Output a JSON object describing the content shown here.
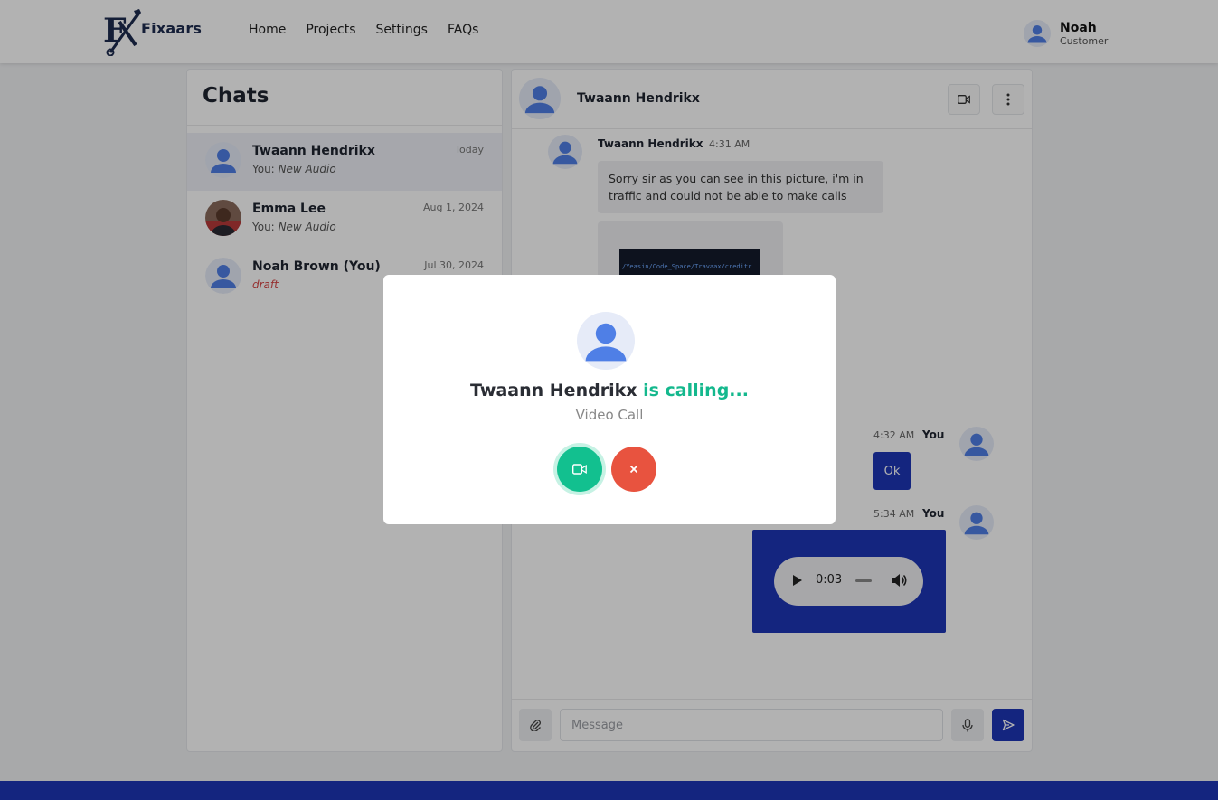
{
  "brand": {
    "name": "Fixaars",
    "logo_letters": "FX"
  },
  "nav": {
    "items": [
      "Home",
      "Projects",
      "Settings",
      "FAQs"
    ]
  },
  "user": {
    "name": "Noah",
    "role": "Customer"
  },
  "chats": {
    "title": "Chats",
    "items": [
      {
        "name": "Twaann Hendrikx",
        "prefix": "You:",
        "preview": "New Audio",
        "date": "Today",
        "active": true
      },
      {
        "name": "Emma Lee",
        "prefix": "You:",
        "preview": "New Audio",
        "date": "Aug 1, 2024"
      },
      {
        "name": "Noah Brown (You)",
        "preview": "draft",
        "date": "Jul 30, 2024"
      }
    ]
  },
  "conversation": {
    "contact_name": "Twaann Hendrikx",
    "messages": [
      {
        "sender": "Twaann Hendrikx",
        "time": "4:31 AM",
        "text": "Sorry sir as you can see in this picture, i'm in traffic and could not be able to make calls",
        "image_text": "/Yeasin/Code_Space/Travaax/creditr"
      },
      {
        "sender": "You",
        "time": "4:32 AM",
        "text": "Ok"
      },
      {
        "sender": "You",
        "time": "5:34 AM",
        "audio_time": "0:03"
      }
    ],
    "composer_placeholder": "Message"
  },
  "call_modal": {
    "caller": "Twaann Hendrikx",
    "status": "is calling...",
    "call_type": "Video Call"
  },
  "colors": {
    "primary": "#1e35b6",
    "accept": "#12c08f",
    "decline": "#e8533f",
    "calling_text": "#14b88d",
    "avatar": "#4f7fe6"
  },
  "icons": [
    "wrench-icon",
    "video-icon",
    "more-vertical-icon",
    "paperclip-icon",
    "mic-icon",
    "send-icon",
    "play-icon",
    "volume-icon",
    "close-icon"
  ]
}
